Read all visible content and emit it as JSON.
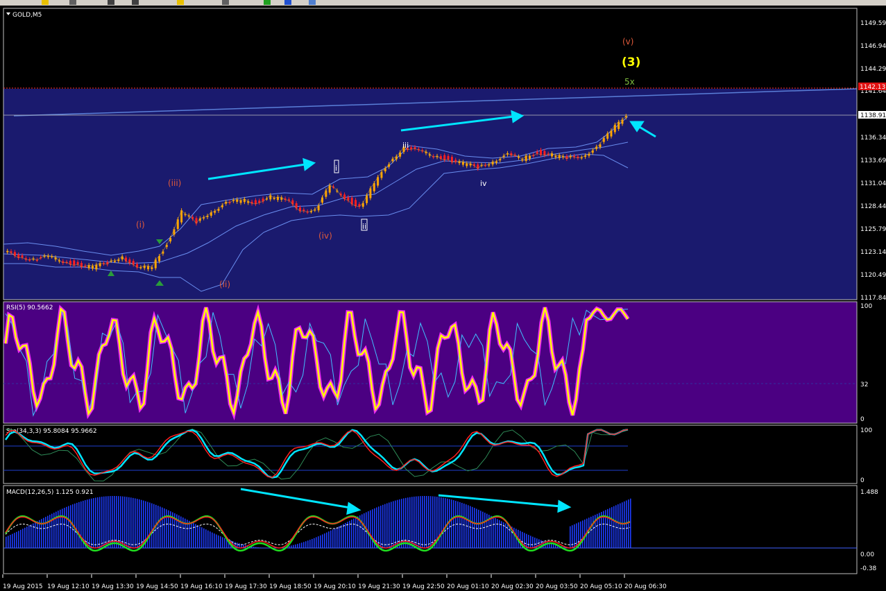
{
  "window": {
    "symbol_title": "GOLD,M5"
  },
  "toolbar": {
    "icons": [
      "yellow-folder-icon",
      "grid-icon",
      "bars-icon",
      "crosshair-icon",
      "zoom-icon",
      "pencil-icon",
      "plus-icon",
      "blue-globe-icon",
      "window-icon"
    ]
  },
  "colors": {
    "main_bg": "#1a1a6e",
    "rsi_bg": "#4b0082",
    "axis_bg": "#000000",
    "wave_orange": "#e05a3a",
    "wave_yellow": "#ffff00",
    "wave_green": "#7fbf3f",
    "arrow": "#00e5ff",
    "price_up": "#ffa500",
    "price_down": "#ff2020"
  },
  "price_axis": {
    "ticks": [
      "1149.59",
      "1146.94",
      "1144.29",
      "1141.64",
      "1138.91",
      "1136.34",
      "1133.69",
      "1131.04",
      "1128.44",
      "1125.79",
      "1123.14",
      "1120.49",
      "1117.84"
    ],
    "current_price": "1142.13",
    "bid_price": "1138.91"
  },
  "time_axis": {
    "ticks": [
      "19 Aug 2015",
      "19 Aug 12:10",
      "19 Aug 13:30",
      "19 Aug 14:50",
      "19 Aug 16:10",
      "19 Aug 17:30",
      "19 Aug 18:50",
      "19 Aug 20:10",
      "19 Aug 21:30",
      "19 Aug 22:50",
      "20 Aug 01:10",
      "20 Aug 02:30",
      "20 Aug 03:50",
      "20 Aug 05:10",
      "20 Aug 06:30"
    ]
  },
  "wave_labels": {
    "v_small": "(v)",
    "three": "(3)",
    "five_x": "5x",
    "iii_paren": "(iii)",
    "i_paren": "(i)",
    "ii_paren": "(ii)",
    "iv_paren": "(iv)",
    "i_box": "i",
    "ii_box": "ii",
    "iii": "iii",
    "iv": "iv"
  },
  "rsi": {
    "header": "RSI(5) 90.5662",
    "scale": [
      "100",
      "32",
      "0"
    ]
  },
  "stoch": {
    "header": "Sto(34,3,3) 95.8084 95.9662",
    "scale": [
      "100",
      "0"
    ]
  },
  "macd": {
    "header": "MACD(12,26,5) 1.125 0.921",
    "scale": [
      "1.488",
      "0.00",
      "-0.38"
    ]
  },
  "chart_data": [
    {
      "type": "line",
      "title": "GOLD,M5",
      "ylim": [
        1117.84,
        1149.59
      ],
      "series": [
        {
          "name": "GOLD",
          "values": [
            1123.0,
            1122.6,
            1122.2,
            1122.4,
            1122.0,
            1121.6,
            1121.2,
            1121.8,
            1122.6,
            1121.0,
            1121.4,
            1124.0,
            1127.6,
            1126.4,
            1127.8,
            1128.6,
            1129.0,
            1128.8,
            1129.4,
            1129.0,
            1128.0,
            1127.8,
            1130.6,
            1129.4,
            1128.2,
            1130.8,
            1133.4,
            1135.2,
            1134.6,
            1134.2,
            1133.8,
            1133.2,
            1132.8,
            1133.6,
            1134.2,
            1133.8,
            1134.6,
            1134.2,
            1133.8,
            1134.2,
            1135.0,
            1137.0,
            1139.0
          ]
        }
      ]
    },
    {
      "type": "line",
      "title": "RSI(5) 90.5662",
      "ylim": [
        0,
        100
      ]
    },
    {
      "type": "line",
      "title": "Sto(34,3,3) 95.8084 95.9662",
      "ylim": [
        0,
        100
      ]
    },
    {
      "type": "bar",
      "title": "MACD(12,26,5) 1.125 0.921",
      "ylim": [
        -0.38,
        1.488
      ]
    }
  ]
}
